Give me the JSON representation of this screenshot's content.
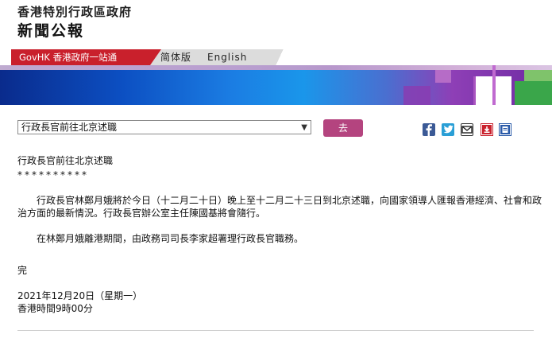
{
  "header": {
    "government_name": "香港特別行政區政府",
    "section_title": "新聞公報"
  },
  "nav": {
    "govhk_label": "GovHK 香港政府一站通",
    "simplified_label": "简体版",
    "english_label": "English"
  },
  "toolbar": {
    "selected_title": "行政長官前往北京述職",
    "go_label": "去"
  },
  "share": {
    "icons": [
      "facebook-icon",
      "twitter-icon",
      "email-icon",
      "download-icon",
      "print-icon"
    ],
    "colors": {
      "facebook": "#3b5a96",
      "twitter": "#2a9fd6",
      "download": "#c9202c",
      "print": "#2a5aa8"
    }
  },
  "article": {
    "headline": "行政長官前往北京述職",
    "stars": "**********",
    "paragraph1": "行政長官林鄭月娥將於今日（十二月二十日）晚上至十二月二十三日到北京述職，向國家領導人匯報香港經濟、社會和政治方面的最新情況。行政長官辦公室主任陳國基將會隨行。",
    "paragraph2": "在林鄭月娥離港期間，由政務司司長李家超署理行政長官職務。",
    "end_mark": "完",
    "date": "2021年12月20日（星期一）",
    "time": "香港時間9時00分"
  },
  "colors": {
    "brand_red": "#c9202c",
    "go_button": "#b4447f"
  }
}
